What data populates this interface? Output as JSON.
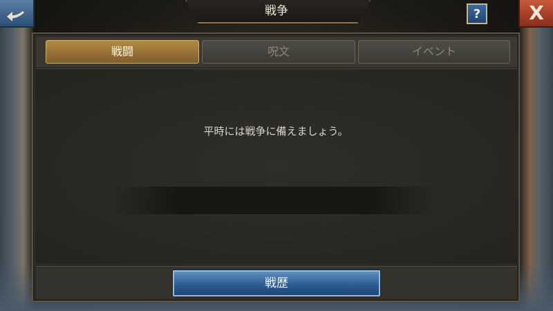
{
  "header": {
    "title": "戦争",
    "back_icon": "back-arrow-icon",
    "help_label": "?",
    "close_label": "X"
  },
  "tabs": [
    {
      "label": "戦闘",
      "active": true
    },
    {
      "label": "呪文",
      "active": false
    },
    {
      "label": "イベント",
      "active": false
    }
  ],
  "content": {
    "message": "平時には戦争に備えましょう。"
  },
  "footer": {
    "history_button_label": "戦歴"
  },
  "colors": {
    "active_tab": "#b48a45",
    "primary_button": "#2c5c92",
    "close_button": "#c75a3c",
    "back_button": "#2c4e75"
  }
}
